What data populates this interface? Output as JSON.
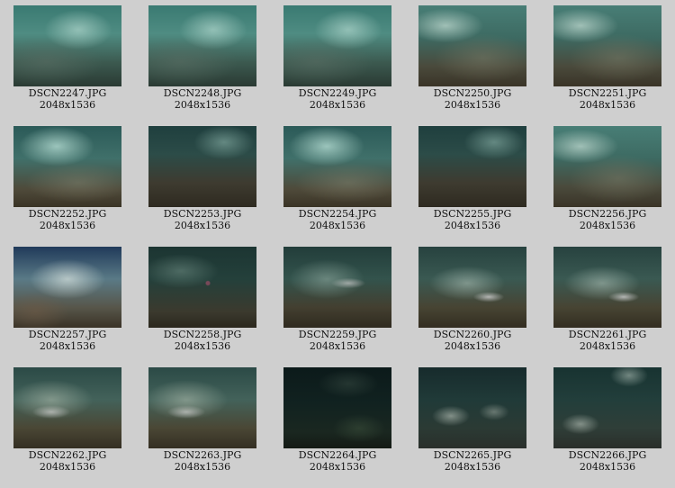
{
  "gallery": {
    "columns": 5,
    "items": [
      {
        "name": "DSCN2247.JPG",
        "dims": "2048x1536",
        "tone": "tone-a"
      },
      {
        "name": "DSCN2248.JPG",
        "dims": "2048x1536",
        "tone": "tone-a"
      },
      {
        "name": "DSCN2249.JPG",
        "dims": "2048x1536",
        "tone": "tone-a"
      },
      {
        "name": "DSCN2250.JPG",
        "dims": "2048x1536",
        "tone": "tone-b"
      },
      {
        "name": "DSCN2251.JPG",
        "dims": "2048x1536",
        "tone": "tone-b"
      },
      {
        "name": "DSCN2252.JPG",
        "dims": "2048x1536",
        "tone": "tone-c"
      },
      {
        "name": "DSCN2253.JPG",
        "dims": "2048x1536",
        "tone": "tone-d"
      },
      {
        "name": "DSCN2254.JPG",
        "dims": "2048x1536",
        "tone": "tone-c"
      },
      {
        "name": "DSCN2255.JPG",
        "dims": "2048x1536",
        "tone": "tone-d"
      },
      {
        "name": "DSCN2256.JPG",
        "dims": "2048x1536",
        "tone": "tone-b"
      },
      {
        "name": "DSCN2257.JPG",
        "dims": "2048x1536",
        "tone": "tone-e"
      },
      {
        "name": "DSCN2258.JPG",
        "dims": "2048x1536",
        "tone": "tone-f"
      },
      {
        "name": "DSCN2259.JPG",
        "dims": "2048x1536",
        "tone": "tone-g"
      },
      {
        "name": "DSCN2260.JPG",
        "dims": "2048x1536",
        "tone": "tone-h"
      },
      {
        "name": "DSCN2261.JPG",
        "dims": "2048x1536",
        "tone": "tone-h"
      },
      {
        "name": "DSCN2262.JPG",
        "dims": "2048x1536",
        "tone": "tone-i"
      },
      {
        "name": "DSCN2263.JPG",
        "dims": "2048x1536",
        "tone": "tone-i"
      },
      {
        "name": "DSCN2264.JPG",
        "dims": "2048x1536",
        "tone": "tone-j"
      },
      {
        "name": "DSCN2265.JPG",
        "dims": "2048x1536",
        "tone": "tone-k"
      },
      {
        "name": "DSCN2266.JPG",
        "dims": "2048x1536",
        "tone": "tone-l"
      }
    ]
  }
}
